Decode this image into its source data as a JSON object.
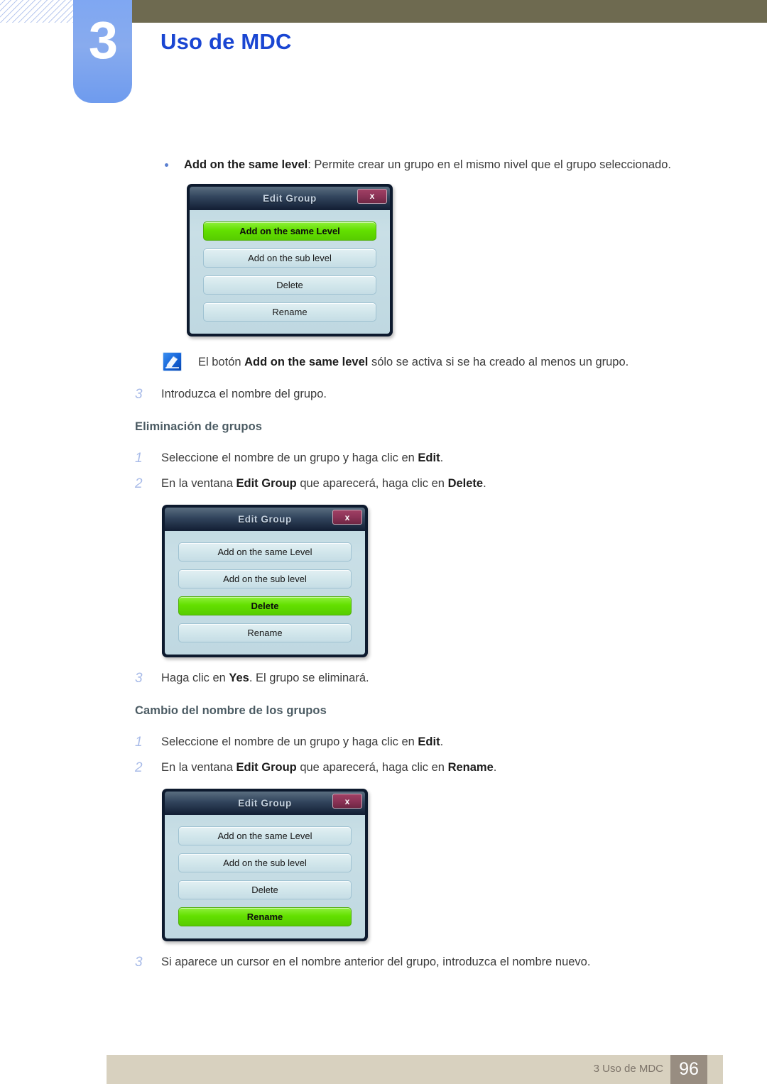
{
  "header": {
    "chapter_number": "3",
    "chapter_title": "Uso de MDC",
    "accent_blue": "#1a46d2",
    "tab_blue": "#7fa7f2",
    "olive": "#6e6a50"
  },
  "bullet": {
    "label_bold": "Add on the same level",
    "text": ": Permite crear un grupo en el mismo nivel que el grupo seleccionado."
  },
  "dialogs": [
    {
      "title": "Edit Group",
      "close_label": "x",
      "buttons": [
        {
          "label": "Add on the same Level",
          "active": true
        },
        {
          "label": "Add on the sub level",
          "active": false
        },
        {
          "label": "Delete",
          "active": false
        },
        {
          "label": "Rename",
          "active": false
        }
      ]
    },
    {
      "title": "Edit Group",
      "close_label": "x",
      "buttons": [
        {
          "label": "Add on the same Level",
          "active": false
        },
        {
          "label": "Add on the sub level",
          "active": false
        },
        {
          "label": "Delete",
          "active": true
        },
        {
          "label": "Rename",
          "active": false
        }
      ]
    },
    {
      "title": "Edit Group",
      "close_label": "x",
      "buttons": [
        {
          "label": "Add on the same Level",
          "active": false
        },
        {
          "label": "Add on the sub level",
          "active": false
        },
        {
          "label": "Delete",
          "active": false
        },
        {
          "label": "Rename",
          "active": true
        }
      ]
    }
  ],
  "note": {
    "text_before": "El botón ",
    "bold": "Add on the same level",
    "text_after": " sólo se activa si se ha creado al menos un grupo.",
    "icon": "note-pen-icon"
  },
  "steps": {
    "add_step3": {
      "num": "3",
      "text": "Introduzca el nombre del grupo."
    },
    "delete_heading": "Eliminación de grupos",
    "delete_step1": {
      "num": "1",
      "before": "Seleccione el nombre de un grupo y haga clic en ",
      "bold": "Edit",
      "after": "."
    },
    "delete_step2": {
      "num": "2",
      "before": "En la ventana ",
      "bold1": "Edit Group",
      "middle": " que aparecerá, haga clic en ",
      "bold2": "Delete",
      "after": "."
    },
    "delete_step3": {
      "num": "3",
      "before": "Haga clic en ",
      "bold": "Yes",
      "after": ". El grupo se eliminará."
    },
    "rename_heading": "Cambio del nombre de los grupos",
    "rename_step1": {
      "num": "1",
      "before": "Seleccione el nombre de un grupo y haga clic en ",
      "bold": "Edit",
      "after": "."
    },
    "rename_step2": {
      "num": "2",
      "before": "En la ventana ",
      "bold1": "Edit Group",
      "middle": " que aparecerá, haga clic en ",
      "bold2": "Rename",
      "after": "."
    },
    "rename_step3": {
      "num": "3",
      "text": "Si aparece un cursor en el nombre anterior del grupo, introduzca el nombre nuevo."
    }
  },
  "footer": {
    "chapter_ref": "3 Uso de MDC",
    "page_number": "96",
    "bar_color": "#d8d1bf",
    "page_box_color": "#988d81"
  }
}
